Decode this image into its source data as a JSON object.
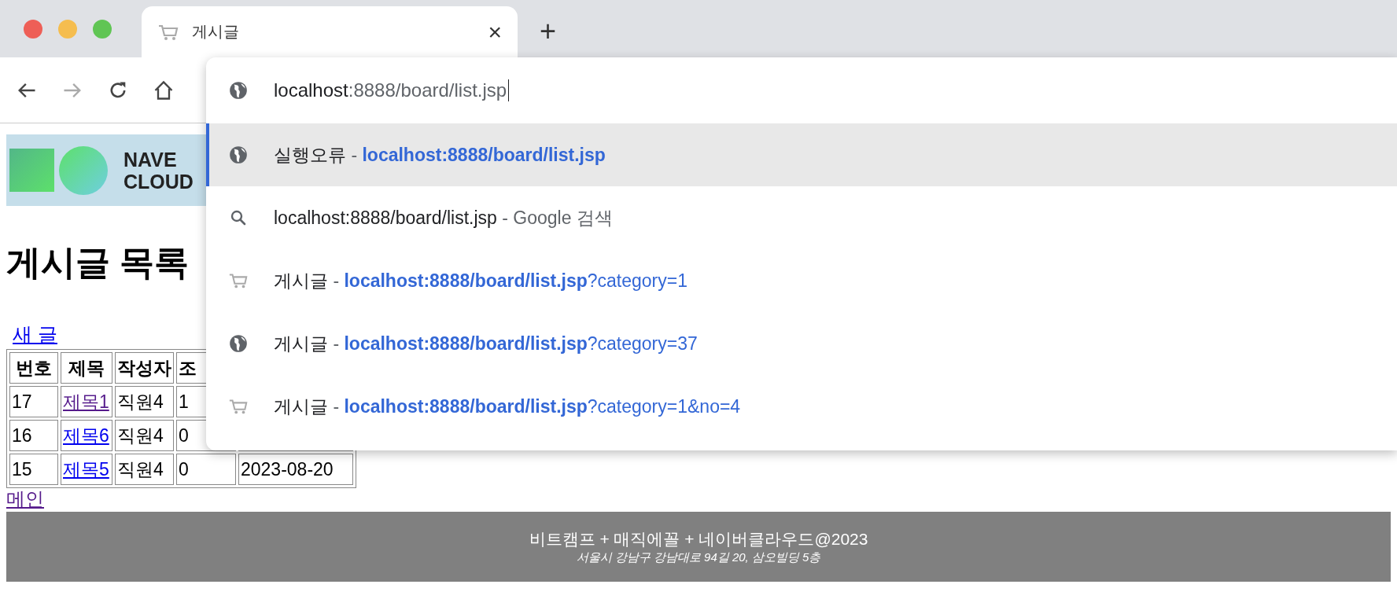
{
  "browser_tab": {
    "title": "게시글",
    "close": "×",
    "new_tab": "+"
  },
  "nav": {
    "back_enabled": true,
    "forward_enabled": false
  },
  "address": {
    "host": "localhost",
    "path": ":8888/board/list.jsp"
  },
  "suggestions": [
    {
      "kind": "url",
      "title": "실행오류",
      "separator": "-",
      "url_match": "localhost:8888/board/list.jsp",
      "selected": true
    },
    {
      "kind": "search",
      "title": "localhost:8888/board/list.jsp",
      "separator": "-",
      "note": "Google 검색",
      "selected": false
    },
    {
      "kind": "history",
      "title": "게시글",
      "separator": "-",
      "url_match": "localhost:8888/board/list.jsp",
      "url_rest": "?category=1",
      "selected": false
    },
    {
      "kind": "url",
      "title": "게시글",
      "separator": "-",
      "url_match": "localhost:8888/board/list.jsp",
      "url_rest": "?category=37",
      "selected": false
    },
    {
      "kind": "history",
      "title": "게시글",
      "separator": "-",
      "url_match": "localhost:8888/board/list.jsp",
      "url_rest": "?category=1&no=4",
      "selected": false
    }
  ],
  "banner": {
    "line_1": "NAVE",
    "line_2": "CLOUD"
  },
  "heading": "게시글 목록",
  "new_post_link": {
    "label": "새 글",
    "visited": false
  },
  "table": {
    "columns": [
      "번호",
      "제목",
      "작성자",
      "조"
    ],
    "rows": [
      {
        "no": "17",
        "title": "제목1",
        "visited": true,
        "author": "직원4",
        "views": "1"
      },
      {
        "no": "16",
        "title": "제목6",
        "visited": false,
        "author": "직원4",
        "views": "0"
      },
      {
        "no": "15",
        "title": "제목5",
        "visited": false,
        "author": "직원4",
        "views": "0",
        "date": "2023-08-20"
      }
    ]
  },
  "main_link": {
    "label": "메인",
    "visited": true
  },
  "footer": {
    "line_1": "비트캠프 + 매직에꼴 + 네이버클라우드@2023",
    "line_2": "서울시 강남구 강남대로 94길 20, 삼오빌딩 5층"
  }
}
